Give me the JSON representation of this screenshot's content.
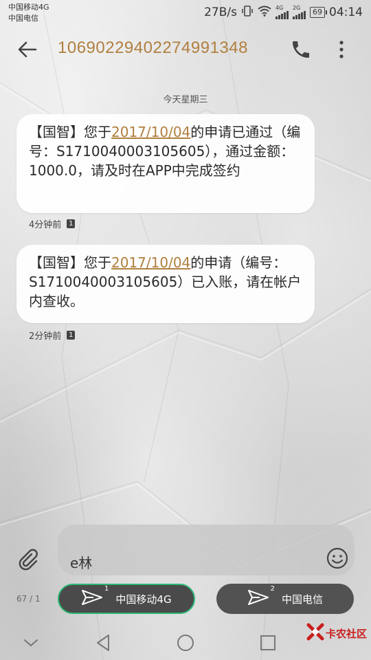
{
  "status_bar": {
    "carrier1": "中国移动4G",
    "carrier2": "中国电信",
    "speed": "27B/s",
    "net1": "4G",
    "net2": "2G",
    "battery": "69",
    "time": "04:14"
  },
  "header": {
    "title": "10690229402274991348"
  },
  "date_separator": "今天星期三",
  "messages": [
    {
      "prefix": "【国智】您于",
      "date": "2017/10/04",
      "suffix": "的申请已通过（编号：S1710040003105605），通过金额：1000.0，请及时在APP中完成签约",
      "time": "4分钟前",
      "sim": "1"
    },
    {
      "prefix": "【国智】您于",
      "date": "2017/10/04",
      "suffix": "的申请（编号：S1710040003105605）已入账，请在帐户内查收。",
      "time": "2分钟前",
      "sim": "1"
    }
  ],
  "composer": {
    "text": "e林",
    "counter": "67 / 1",
    "send1": {
      "label": "中国移动4G",
      "sim": "1"
    },
    "send2": {
      "label": "中国电信",
      "sim": "2"
    }
  },
  "watermark": "卡农社区",
  "colors": {
    "accent": "#b07f3e",
    "send_outline": "#2bb673",
    "watermark": "#c8201e"
  }
}
